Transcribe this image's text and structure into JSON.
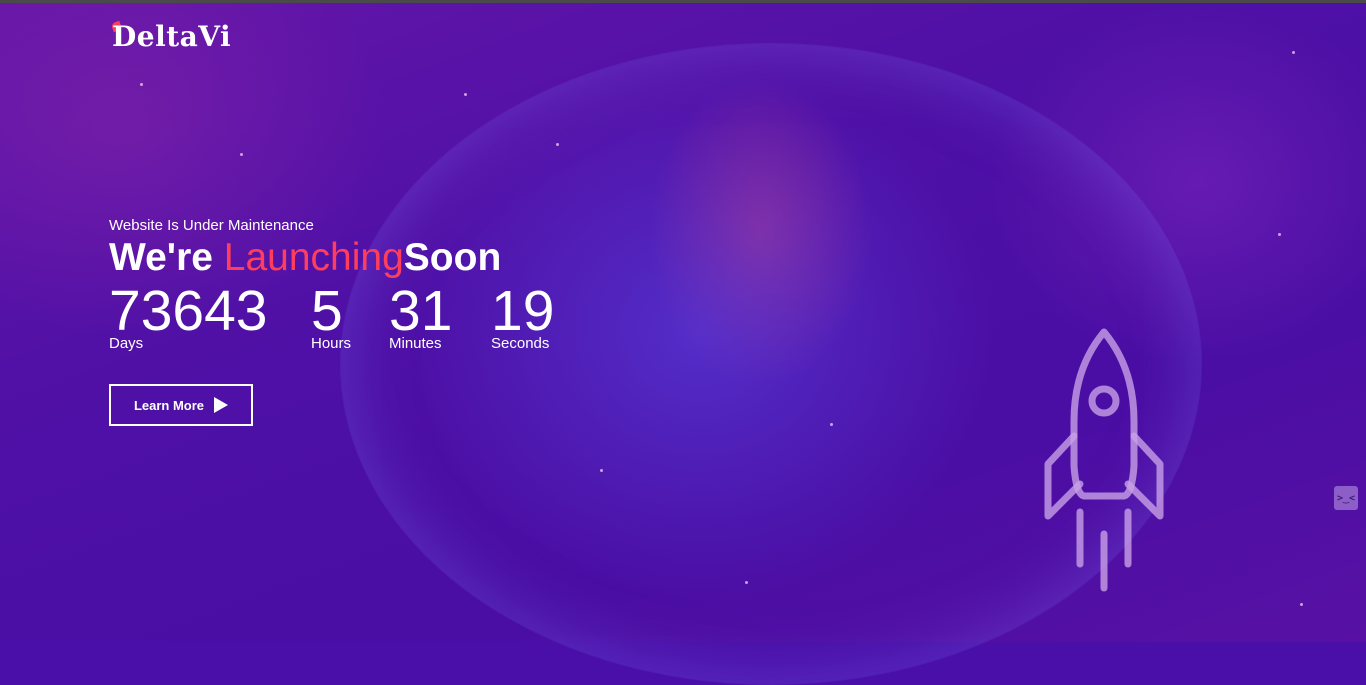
{
  "brand": {
    "logo_text": "DeltaVi",
    "accent_color": "#ff3e5c"
  },
  "hero": {
    "subtitle": "Website Is Under Maintenance",
    "headline_prefix": "We're ",
    "headline_accent": "Launching",
    "headline_suffix": "Soon"
  },
  "countdown": {
    "days": {
      "value": "73643",
      "label": "Days"
    },
    "hours": {
      "value": "5",
      "label": "Hours"
    },
    "minutes": {
      "value": "31",
      "label": "Minutes"
    },
    "seconds": {
      "value": "19",
      "label": "Seconds"
    }
  },
  "cta": {
    "label": "Learn More",
    "icon": "play-icon"
  },
  "decor": {
    "rocket_icon": "rocket-icon",
    "side_handle_icon": "collapse-icon",
    "side_handle_text": ">‿<"
  }
}
